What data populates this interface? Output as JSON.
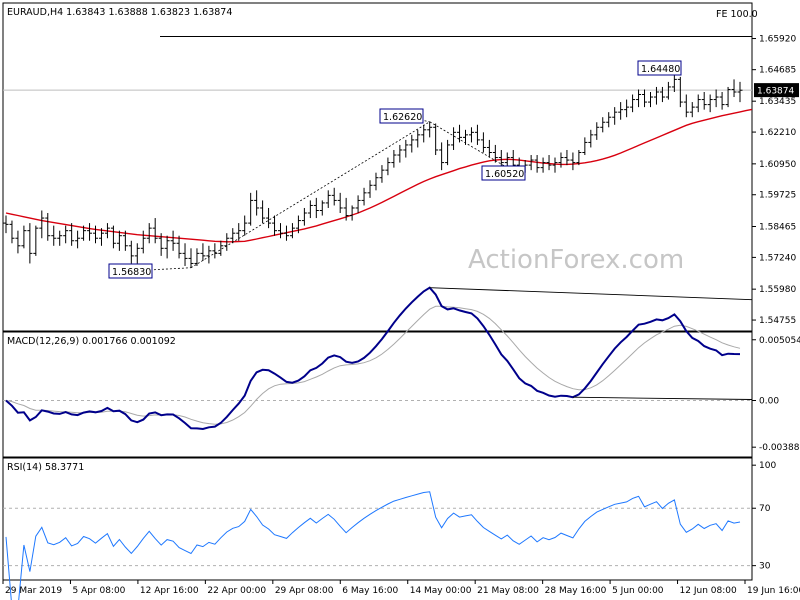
{
  "chart_data": [
    {
      "type": "ohlc",
      "header": "EURAUD,H4  1.63843 1.63888 1.63823 1.63874",
      "fe_label": "FE 100.0",
      "fe_level": 1.66,
      "last_price": "1.63874",
      "last_value": 1.63874,
      "ylim": [
        1.544,
        1.6725
      ],
      "yticks": [
        "1.65920",
        "1.64685",
        "1.63435",
        "1.62210",
        "1.60950",
        "1.59725",
        "1.58465",
        "1.57240",
        "1.55980",
        "1.54755"
      ],
      "annotations": [
        {
          "text": "1.56830",
          "value": 1.5683
        },
        {
          "text": "1.62620",
          "value": 1.6262
        },
        {
          "text": "1.60520",
          "value": 1.6052
        },
        {
          "text": "1.64480",
          "value": 1.6448
        }
      ],
      "watermark": "ActionForex.com",
      "bars": [
        [
          1.586,
          1.589,
          1.582,
          1.5855
        ],
        [
          1.5855,
          1.587,
          1.578,
          1.58
        ],
        [
          1.58,
          1.583,
          1.574,
          1.577
        ],
        [
          1.577,
          1.585,
          1.576,
          1.583
        ],
        [
          1.583,
          1.586,
          1.57,
          1.574
        ],
        [
          1.574,
          1.585,
          1.573,
          1.584
        ],
        [
          1.584,
          1.591,
          1.58,
          1.588
        ],
        [
          1.588,
          1.59,
          1.579,
          1.581
        ],
        [
          1.581,
          1.585,
          1.577,
          1.58
        ],
        [
          1.58,
          1.583,
          1.577,
          1.581
        ],
        [
          1.581,
          1.585,
          1.578,
          1.583
        ],
        [
          1.583,
          1.586,
          1.577,
          1.579
        ],
        [
          1.579,
          1.583,
          1.576,
          1.58
        ],
        [
          1.58,
          1.585,
          1.579,
          1.583
        ],
        [
          1.583,
          1.586,
          1.579,
          1.582
        ],
        [
          1.582,
          1.585,
          1.578,
          1.58
        ],
        [
          1.58,
          1.584,
          1.577,
          1.582
        ],
        [
          1.582,
          1.586,
          1.58,
          1.584
        ],
        [
          1.584,
          1.585,
          1.576,
          1.578
        ],
        [
          1.578,
          1.583,
          1.575,
          1.581
        ],
        [
          1.581,
          1.583,
          1.575,
          1.577
        ],
        [
          1.577,
          1.579,
          1.57,
          1.573
        ],
        [
          1.573,
          1.578,
          1.57,
          1.576
        ],
        [
          1.576,
          1.583,
          1.574,
          1.58
        ],
        [
          1.58,
          1.586,
          1.578,
          1.584
        ],
        [
          1.584,
          1.588,
          1.578,
          1.58
        ],
        [
          1.58,
          1.582,
          1.573,
          1.576
        ],
        [
          1.576,
          1.581,
          1.572,
          1.579
        ],
        [
          1.579,
          1.583,
          1.575,
          1.578
        ],
        [
          1.578,
          1.581,
          1.572,
          1.574
        ],
        [
          1.574,
          1.578,
          1.569,
          1.572
        ],
        [
          1.572,
          1.576,
          1.5683,
          1.57
        ],
        [
          1.57,
          1.576,
          1.569,
          1.574
        ],
        [
          1.574,
          1.578,
          1.571,
          1.573
        ],
        [
          1.573,
          1.577,
          1.57,
          1.575
        ],
        [
          1.575,
          1.578,
          1.572,
          1.574
        ],
        [
          1.574,
          1.579,
          1.573,
          1.577
        ],
        [
          1.577,
          1.582,
          1.575,
          1.58
        ],
        [
          1.58,
          1.584,
          1.578,
          1.582
        ],
        [
          1.582,
          1.586,
          1.579,
          1.583
        ],
        [
          1.583,
          1.589,
          1.581,
          1.586
        ],
        [
          1.586,
          1.598,
          1.585,
          1.595
        ],
        [
          1.595,
          1.599,
          1.589,
          1.592
        ],
        [
          1.592,
          1.595,
          1.586,
          1.588
        ],
        [
          1.588,
          1.592,
          1.584,
          1.586
        ],
        [
          1.586,
          1.589,
          1.581,
          1.583
        ],
        [
          1.583,
          1.586,
          1.58,
          1.582
        ],
        [
          1.582,
          1.585,
          1.579,
          1.581
        ],
        [
          1.581,
          1.586,
          1.58,
          1.584
        ],
        [
          1.584,
          1.589,
          1.582,
          1.587
        ],
        [
          1.587,
          1.592,
          1.585,
          1.59
        ],
        [
          1.59,
          1.595,
          1.588,
          1.593
        ],
        [
          1.593,
          1.596,
          1.588,
          1.591
        ],
        [
          1.591,
          1.595,
          1.589,
          1.594
        ],
        [
          1.594,
          1.599,
          1.592,
          1.597
        ],
        [
          1.597,
          1.6,
          1.593,
          1.595
        ],
        [
          1.595,
          1.598,
          1.59,
          1.592
        ],
        [
          1.592,
          1.596,
          1.587,
          1.589
        ],
        [
          1.589,
          1.593,
          1.587,
          1.592
        ],
        [
          1.592,
          1.597,
          1.59,
          1.595
        ],
        [
          1.595,
          1.6,
          1.593,
          1.598
        ],
        [
          1.598,
          1.603,
          1.596,
          1.601
        ],
        [
          1.601,
          1.606,
          1.599,
          1.604
        ],
        [
          1.604,
          1.609,
          1.602,
          1.607
        ],
        [
          1.607,
          1.612,
          1.605,
          1.61
        ],
        [
          1.61,
          1.615,
          1.608,
          1.613
        ],
        [
          1.613,
          1.617,
          1.61,
          1.615
        ],
        [
          1.615,
          1.619,
          1.612,
          1.617
        ],
        [
          1.617,
          1.621,
          1.614,
          1.619
        ],
        [
          1.619,
          1.623,
          1.616,
          1.621
        ],
        [
          1.621,
          1.625,
          1.618,
          1.623
        ],
        [
          1.623,
          1.6262,
          1.62,
          1.624
        ],
        [
          1.624,
          1.6255,
          1.613,
          1.615
        ],
        [
          1.615,
          1.618,
          1.607,
          1.61
        ],
        [
          1.61,
          1.619,
          1.609,
          1.617
        ],
        [
          1.617,
          1.624,
          1.615,
          1.622
        ],
        [
          1.622,
          1.625,
          1.618,
          1.62
        ],
        [
          1.62,
          1.623,
          1.617,
          1.621
        ],
        [
          1.621,
          1.624,
          1.618,
          1.622
        ],
        [
          1.622,
          1.625,
          1.617,
          1.619
        ],
        [
          1.619,
          1.622,
          1.614,
          1.616
        ],
        [
          1.616,
          1.619,
          1.612,
          1.614
        ],
        [
          1.614,
          1.617,
          1.61,
          1.612
        ],
        [
          1.612,
          1.615,
          1.608,
          1.61
        ],
        [
          1.61,
          1.614,
          1.608,
          1.612
        ],
        [
          1.612,
          1.615,
          1.607,
          1.609
        ],
        [
          1.609,
          1.612,
          1.6052,
          1.607
        ],
        [
          1.607,
          1.611,
          1.606,
          1.609
        ],
        [
          1.609,
          1.613,
          1.607,
          1.611
        ],
        [
          1.611,
          1.613,
          1.606,
          1.608
        ],
        [
          1.608,
          1.612,
          1.606,
          1.61
        ],
        [
          1.61,
          1.613,
          1.607,
          1.609
        ],
        [
          1.609,
          1.612,
          1.606,
          1.61
        ],
        [
          1.61,
          1.614,
          1.608,
          1.612
        ],
        [
          1.612,
          1.615,
          1.609,
          1.611
        ],
        [
          1.611,
          1.614,
          1.607,
          1.61
        ],
        [
          1.61,
          1.615,
          1.609,
          1.614
        ],
        [
          1.614,
          1.62,
          1.613,
          1.618
        ],
        [
          1.618,
          1.623,
          1.616,
          1.621
        ],
        [
          1.621,
          1.626,
          1.619,
          1.624
        ],
        [
          1.624,
          1.628,
          1.622,
          1.626
        ],
        [
          1.626,
          1.63,
          1.624,
          1.628
        ],
        [
          1.628,
          1.632,
          1.625,
          1.63
        ],
        [
          1.63,
          1.634,
          1.627,
          1.631
        ],
        [
          1.631,
          1.635,
          1.628,
          1.632
        ],
        [
          1.632,
          1.637,
          1.63,
          1.635
        ],
        [
          1.635,
          1.639,
          1.632,
          1.637
        ],
        [
          1.637,
          1.639,
          1.632,
          1.634
        ],
        [
          1.634,
          1.638,
          1.632,
          1.636
        ],
        [
          1.636,
          1.64,
          1.633,
          1.638
        ],
        [
          1.638,
          1.64,
          1.634,
          1.636
        ],
        [
          1.636,
          1.642,
          1.635,
          1.64
        ],
        [
          1.64,
          1.6448,
          1.638,
          1.643
        ],
        [
          1.643,
          1.644,
          1.632,
          1.634
        ],
        [
          1.634,
          1.637,
          1.628,
          1.63
        ],
        [
          1.63,
          1.634,
          1.628,
          1.632
        ],
        [
          1.632,
          1.637,
          1.63,
          1.635
        ],
        [
          1.635,
          1.638,
          1.631,
          1.633
        ],
        [
          1.633,
          1.637,
          1.63,
          1.635
        ],
        [
          1.635,
          1.639,
          1.632,
          1.636
        ],
        [
          1.636,
          1.638,
          1.631,
          1.633
        ],
        [
          1.633,
          1.64,
          1.632,
          1.639
        ],
        [
          1.639,
          1.643,
          1.636,
          1.638
        ],
        [
          1.638,
          1.642,
          1.634,
          1.6387
        ]
      ],
      "ma": [
        1.59,
        1.5895,
        1.589,
        1.5885,
        1.588,
        1.5875,
        1.587,
        1.5866,
        1.5862,
        1.5858,
        1.5854,
        1.585,
        1.5846,
        1.5842,
        1.5838,
        1.5835,
        1.5832,
        1.5829,
        1.5826,
        1.5823,
        1.582,
        1.5817,
        1.5814,
        1.5812,
        1.581,
        1.5808,
        1.5806,
        1.5804,
        1.5802,
        1.58,
        1.5798,
        1.5796,
        1.5794,
        1.5792,
        1.579,
        1.5788,
        1.5787,
        1.5786,
        1.5786,
        1.5787,
        1.5788,
        1.5792,
        1.5797,
        1.5802,
        1.5807,
        1.5812,
        1.5817,
        1.5822,
        1.5827,
        1.5832,
        1.5837,
        1.5843,
        1.5849,
        1.5856,
        1.5863,
        1.587,
        1.5877,
        1.5884,
        1.5892,
        1.59,
        1.591,
        1.592,
        1.5931,
        1.5942,
        1.5954,
        1.5966,
        1.5978,
        1.599,
        1.6002,
        1.6014,
        1.6025,
        1.6035,
        1.6044,
        1.6052,
        1.606,
        1.6068,
        1.6076,
        1.6083,
        1.609,
        1.6096,
        1.6102,
        1.6107,
        1.611,
        1.6112,
        1.6113,
        1.6112,
        1.611,
        1.6107,
        1.6104,
        1.6101,
        1.6098,
        1.6096,
        1.6094,
        1.6093,
        1.6093,
        1.6094,
        1.6096,
        1.6099,
        1.6103,
        1.6108,
        1.6114,
        1.6121,
        1.6129,
        1.6138,
        1.6148,
        1.6158,
        1.6168,
        1.6178,
        1.6188,
        1.6198,
        1.6208,
        1.6218,
        1.6228,
        1.6238,
        1.6248,
        1.6256,
        1.6262,
        1.6268,
        1.6274,
        1.628,
        1.6286,
        1.6291,
        1.6296,
        1.6301,
        1.6306,
        1.6311
      ]
    },
    {
      "type": "line",
      "header": "MACD(12,26,9) 0.001766 0.001092",
      "ylim": [
        -0.0047,
        0.0057
      ],
      "yticks": [
        "0.005054",
        "0.00",
        "-0.003883"
      ],
      "zero_label": "0.00"
    },
    {
      "type": "line",
      "header": "RSI(14) 58.3771",
      "ylim": [
        20,
        105
      ],
      "yticks": [
        "100",
        "70",
        "30"
      ],
      "levels": [
        70,
        30
      ]
    }
  ],
  "x_labels": [
    "29 Mar 2019",
    "5 Apr 08:00",
    "12 Apr 16:00",
    "22 Apr 00:00",
    "29 Apr 08:00",
    "6 May 16:00",
    "14 May 00:00",
    "21 May 08:00",
    "28 May 16:00",
    "5 Jun 00:00",
    "12 Jun 08:00",
    "19 Jun 16:00"
  ],
  "colors": {
    "bars": "#000000",
    "ma": "#d8000f",
    "macd": "#00008b",
    "signal": "#a9a9a9",
    "rsi": "#1e78ff",
    "guide": "#000000",
    "watermark": "#c6c6c6"
  }
}
